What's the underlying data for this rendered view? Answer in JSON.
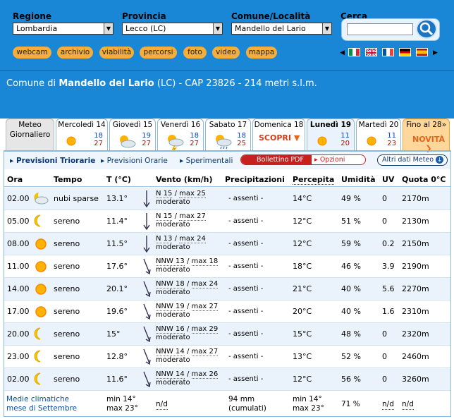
{
  "search": {
    "region_label": "Regione",
    "region_value": "Lombardia",
    "province_label": "Provincia",
    "province_value": "Lecco (LC)",
    "comune_label": "Comune/Località",
    "comune_value": "Mandello del Lario",
    "search_label": "Cerca"
  },
  "links": [
    "webcam",
    "archivio",
    "viabilità",
    "percorsi",
    "foto",
    "video",
    "mappa"
  ],
  "flags": [
    "italy-flag",
    "uk-flag",
    "france-flag",
    "germany-flag",
    "spain-flag"
  ],
  "place": {
    "prefix": "Comune di",
    "name": "Mandello del Lario",
    "suffix": "(LC) - CAP 23826 - 214 metri s.l.m."
  },
  "tabs": {
    "meteo": {
      "line1": "Meteo",
      "line2": "Giornaliero"
    },
    "days": [
      {
        "name": "Mercoledì 14",
        "min": "18",
        "max": "27",
        "icon": "sun-icon"
      },
      {
        "name": "Giovedì 15",
        "min": "19",
        "max": "27",
        "icon": "partly-cloudy-icon"
      },
      {
        "name": "Venerdì 16",
        "min": "18",
        "max": "27",
        "icon": "storm-sun-icon"
      },
      {
        "name": "Sabato 17",
        "min": "18",
        "max": "25",
        "icon": "rain-sun-icon"
      },
      {
        "name": "Domenica 18",
        "cta": "SCOPRI"
      },
      {
        "name": "Lunedì 19",
        "min": "11",
        "max": "20",
        "icon": "sun-icon"
      },
      {
        "name": "Martedì 20",
        "min": "11",
        "max": "23",
        "icon": "sun-icon"
      },
      {
        "name": "Fino al 28»",
        "cta": "NOVITÀ"
      }
    ]
  },
  "subnav": {
    "triorarie": "Previsioni Triorarie",
    "orarie": "Previsioni Orarie",
    "sperimentali": "Sperimentali",
    "bollettino": "Bollettino PDF",
    "opzioni": "Opzioni",
    "altri": "Altri dati Meteo"
  },
  "headers": [
    "Ora",
    "Tempo",
    "T (°C)",
    "Vento (km/h)",
    "Precipitazioni",
    "Percepita",
    "Umidità",
    "UV",
    "Quota 0°C"
  ],
  "rows": [
    {
      "ora": "02.00",
      "icon": "partly-cloudy-night-icon",
      "tempo": "nubi sparse",
      "t": "13.1°",
      "dir": "N 15",
      "max": "max 25",
      "forza": "moderato",
      "prec": "- assenti -",
      "perc": "14°C",
      "umid": "49 %",
      "uv": "0",
      "quota": "2170m"
    },
    {
      "ora": "05.00",
      "icon": "moon-icon",
      "tempo": "sereno",
      "t": "11.4°",
      "dir": "N 15",
      "max": "max 27",
      "forza": "moderato",
      "prec": "- assenti -",
      "perc": "12°C",
      "umid": "51 %",
      "uv": "0",
      "quota": "2130m"
    },
    {
      "ora": "08.00",
      "icon": "sun-icon",
      "tempo": "sereno",
      "t": "11.5°",
      "dir": "N 13",
      "max": "max 24",
      "forza": "moderato",
      "prec": "- assenti -",
      "perc": "12°C",
      "umid": "59 %",
      "uv": "0.2",
      "quota": "2150m"
    },
    {
      "ora": "11.00",
      "icon": "sun-icon",
      "tempo": "sereno",
      "t": "17.6°",
      "dir": "NNW 13",
      "max": "max 18",
      "forza": "moderato",
      "prec": "- assenti -",
      "perc": "18°C",
      "umid": "46 %",
      "uv": "3.9",
      "quota": "2190m"
    },
    {
      "ora": "14.00",
      "icon": "sun-icon",
      "tempo": "sereno",
      "t": "20.1°",
      "dir": "NNW 18",
      "max": "max 24",
      "forza": "moderato",
      "prec": "- assenti -",
      "perc": "21°C",
      "umid": "40 %",
      "uv": "5.6",
      "quota": "2270m"
    },
    {
      "ora": "17.00",
      "icon": "sun-icon",
      "tempo": "sereno",
      "t": "19.6°",
      "dir": "NNW 19",
      "max": "max 27",
      "forza": "moderato",
      "prec": "- assenti -",
      "perc": "20°C",
      "umid": "40 %",
      "uv": "1.6",
      "quota": "2310m"
    },
    {
      "ora": "20.00",
      "icon": "moon-icon",
      "tempo": "sereno",
      "t": "15°",
      "dir": "NNW 16",
      "max": "max 29",
      "forza": "moderato",
      "prec": "- assenti -",
      "perc": "15°C",
      "umid": "48 %",
      "uv": "0",
      "quota": "2320m"
    },
    {
      "ora": "23.00",
      "icon": "moon-icon",
      "tempo": "sereno",
      "t": "12.8°",
      "dir": "NNW 14",
      "max": "max 27",
      "forza": "moderato",
      "prec": "- assenti -",
      "perc": "13°C",
      "umid": "52 %",
      "uv": "0",
      "quota": "2460m"
    },
    {
      "ora": "02.00",
      "icon": "moon-icon",
      "tempo": "sereno",
      "t": "11.6°",
      "dir": "NNW 14",
      "max": "max 26",
      "forza": "moderato",
      "prec": "- assenti -",
      "perc": "12°C",
      "umid": "56 %",
      "uv": "0",
      "quota": "3260m"
    }
  ],
  "footer": {
    "label1": "Medie climatiche",
    "label2": "mese di Settembre",
    "tmin": "min 14°",
    "tmax": "max 23°",
    "vento": "n/d",
    "prec1": "94 mm",
    "prec2": "(cumulati)",
    "pmin": "min 14°",
    "pmax": "max 23°",
    "umid": "71 %",
    "uv": "n/d",
    "quota": "n/d"
  },
  "colors": {
    "header_blue": "#1a87d6",
    "pill_orange": "#f5ae3b",
    "min_blue": "#0b3fae",
    "max_red": "#c00000"
  }
}
